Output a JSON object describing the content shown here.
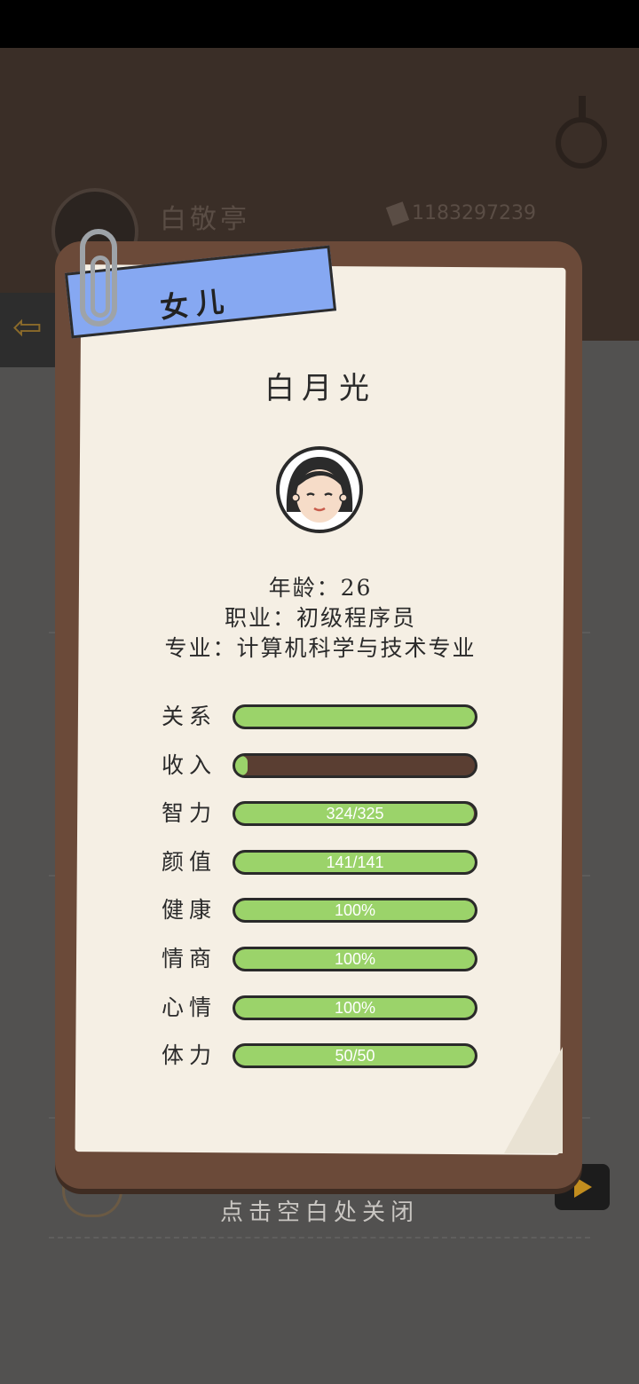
{
  "background": {
    "player_name": "白敬亭",
    "money": "1183297239"
  },
  "popup": {
    "relation_tag": "女儿",
    "character_name": "白月光",
    "info": {
      "age": "年龄：26",
      "job": "职业：初级程序员",
      "major": "专业：计算机科学与技术专业"
    },
    "stats": [
      {
        "label": "关系",
        "value_text": "",
        "fill": 1.0
      },
      {
        "label": "收入",
        "value_text": "",
        "fill": 0.04
      },
      {
        "label": "智力",
        "value_text": "324/325",
        "fill": 0.997
      },
      {
        "label": "颜值",
        "value_text": "141/141",
        "fill": 1.0
      },
      {
        "label": "健康",
        "value_text": "100%",
        "fill": 1.0
      },
      {
        "label": "情商",
        "value_text": "100%",
        "fill": 1.0
      },
      {
        "label": "心情",
        "value_text": "100%",
        "fill": 1.0
      },
      {
        "label": "体力",
        "value_text": "50/50",
        "fill": 1.0
      }
    ],
    "close_hint": "点击空白处关闭"
  },
  "colors": {
    "bar_fill": "#9bd36a",
    "bar_empty": "#5a3e32",
    "ribbon": "#86a8f2",
    "paper": "#f5efe4",
    "card_frame": "#6b4a39"
  }
}
